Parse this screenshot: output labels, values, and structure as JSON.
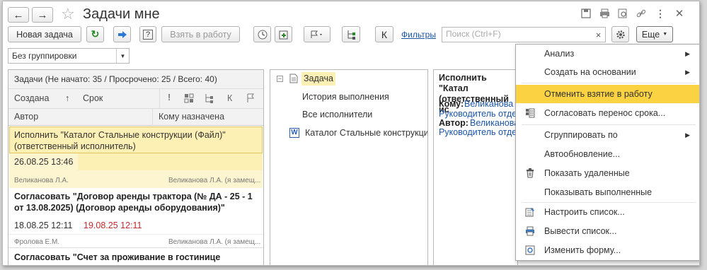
{
  "window": {
    "title": "Задачи мне"
  },
  "toolbar": {
    "new_task": "Новая задача",
    "take_to_work": "Взять в работу",
    "filters": "Фильтры",
    "search_placeholder": "Поиск (Ctrl+F)",
    "more": "Еще",
    "k_label": "К"
  },
  "grouping": {
    "selected": "Без группировки"
  },
  "list": {
    "summary": "Задачи (Не начато: 35 / Просрочено: 25 / Всего: 40)",
    "columns": {
      "created": "Создана",
      "sort_arrow": "↑",
      "deadline": "Срок",
      "k": "К",
      "author": "Автор",
      "assignee": "Кому назначена"
    },
    "items": [
      {
        "title": "Исполнить \"Каталог Стальные конструкции (Файл)\" (ответственный исполнитель)",
        "date": "26.08.25 13:46",
        "deadline": "",
        "author": "Великанова Л.А.",
        "assignee": "Великанова Л.А. (я замещ..."
      },
      {
        "title": "Согласовать \"Договор аренды трактора (№ ДА - 25 - 1 от 13.08.2025) (Договор аренды оборудования)\"",
        "date": "18.08.25 12:11",
        "deadline": "19.08.25 12:11",
        "author": "Фролова Е.М.",
        "assignee": "Великанова Л.А. (я замещ..."
      },
      {
        "title": "Согласовать \"Счет за проживание в гостинице",
        "date": "",
        "deadline": "",
        "author": "",
        "assignee": ""
      }
    ]
  },
  "tree": {
    "root": "Задача",
    "items": [
      "История выполнения",
      "Все исполнители",
      "Каталог Стальные конструкции ("
    ]
  },
  "preview": {
    "title": "Исполнить \"Катал (ответственный ис",
    "to_label": "Кому:",
    "to_value": "Великанова Л",
    "to_value2": "Руководитель отдел",
    "author_label": "Автор:",
    "author_value": "Великанова Л",
    "author_value2": "Руководитель отдел"
  },
  "menu": {
    "items": [
      {
        "label": "Анализ",
        "submenu": true,
        "icon": ""
      },
      {
        "label": "Создать на основании",
        "submenu": true,
        "icon": ""
      },
      {
        "label": "Отменить взятие в работу",
        "submenu": false,
        "icon": "",
        "highlighted": true
      },
      {
        "label": "Согласовать перенос срока...",
        "submenu": false,
        "icon": "approve-icon"
      },
      {
        "label": "Сгруппировать по",
        "submenu": true,
        "icon": ""
      },
      {
        "label": "Автообновление...",
        "submenu": false,
        "icon": ""
      },
      {
        "label": "Показать удаленные",
        "submenu": false,
        "icon": "trash-icon"
      },
      {
        "label": "Показывать выполненные",
        "submenu": false,
        "icon": ""
      },
      {
        "label": "Настроить список...",
        "submenu": false,
        "icon": "settings-list-icon"
      },
      {
        "label": "Вывести список...",
        "submenu": false,
        "icon": "print-list-icon"
      },
      {
        "label": "Изменить форму...",
        "submenu": false,
        "icon": "form-icon"
      }
    ]
  },
  "colors": {
    "highlight": "#fbd241",
    "selected_row": "#fdf0b4",
    "selected_row_date": "#fdf5cf",
    "link": "#1a55a8",
    "overdue": "#c0282d"
  }
}
